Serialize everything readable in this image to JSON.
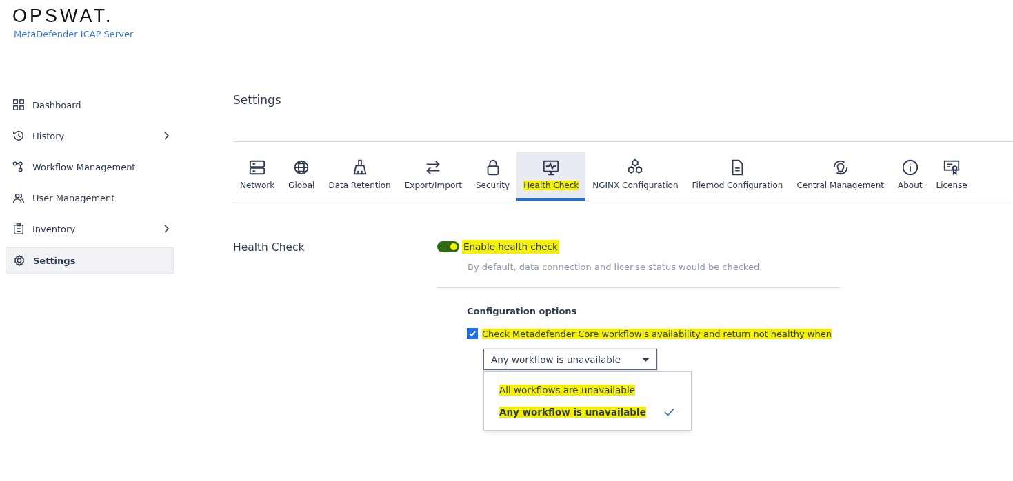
{
  "brand": {
    "logo": "OPSWAT.",
    "product": "MetaDefender ICAP Server"
  },
  "sidebar": {
    "items": [
      {
        "label": "Dashboard",
        "kind": "grid",
        "has_submenu": false,
        "selected": false
      },
      {
        "label": "History",
        "kind": "history",
        "has_submenu": true,
        "selected": false
      },
      {
        "label": "Workflow Management",
        "kind": "workflow",
        "has_submenu": false,
        "selected": false
      },
      {
        "label": "User Management",
        "kind": "users",
        "has_submenu": false,
        "selected": false
      },
      {
        "label": "Inventory",
        "kind": "clipboard",
        "has_submenu": true,
        "selected": false
      },
      {
        "label": "Settings",
        "kind": "gear",
        "has_submenu": false,
        "selected": true
      }
    ]
  },
  "page_title": "Settings",
  "tabs": [
    {
      "label": "Network",
      "kind": "server",
      "selected": false,
      "highlighted": false
    },
    {
      "label": "Global",
      "kind": "globe",
      "selected": false,
      "highlighted": false
    },
    {
      "label": "Data Retention",
      "kind": "broom",
      "selected": false,
      "highlighted": false
    },
    {
      "label": "Export/Import",
      "kind": "arrows",
      "selected": false,
      "highlighted": false
    },
    {
      "label": "Security",
      "kind": "lock",
      "selected": false,
      "highlighted": false
    },
    {
      "label": "Health Check",
      "kind": "monitor",
      "selected": true,
      "highlighted": true
    },
    {
      "label": "NGINX Configuration",
      "kind": "hexagons",
      "selected": false,
      "highlighted": false
    },
    {
      "label": "Filemod Configuration",
      "kind": "file",
      "selected": false,
      "highlighted": false
    },
    {
      "label": "Central Management",
      "kind": "bulb",
      "selected": false,
      "highlighted": false
    },
    {
      "label": "About",
      "kind": "info",
      "selected": false,
      "highlighted": false
    },
    {
      "label": "License",
      "kind": "certificate",
      "selected": false,
      "highlighted": false
    }
  ],
  "section": {
    "title": "Health Check",
    "toggle": {
      "label": "Enable health check",
      "on": true,
      "highlighted": true
    },
    "toggle_hint": "By default, data connection and license status would be checked.",
    "options_title": "Configuration options",
    "checkbox": {
      "label": "Check Metadefender Core workflow's availability and return not healthy when",
      "checked": true,
      "highlighted": true
    },
    "dropdown": {
      "value": "Any workflow is unavailable",
      "expanded": true,
      "options": [
        {
          "label": "All workflows are unavailable",
          "selected": false,
          "highlighted": true
        },
        {
          "label": "Any workflow is unavailable",
          "selected": true,
          "highlighted": true
        }
      ]
    }
  }
}
